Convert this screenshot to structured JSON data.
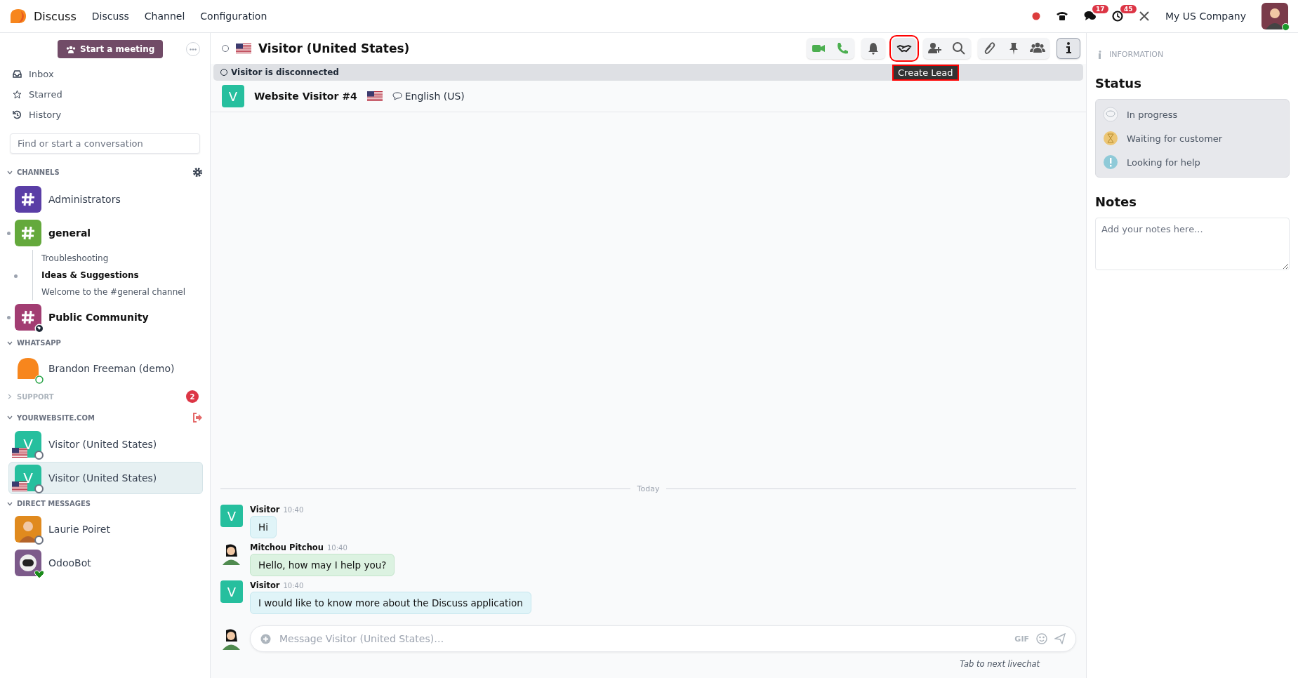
{
  "app_name": "Discuss",
  "menu": [
    "Discuss",
    "Channel",
    "Configuration"
  ],
  "systray": {
    "chat_count": "17",
    "activity_count": "45",
    "company": "My US Company"
  },
  "sidebar": {
    "meeting_button": "Start a meeting",
    "nav": [
      {
        "label": "Inbox",
        "kind": "inbox"
      },
      {
        "label": "Starred",
        "kind": "star"
      },
      {
        "label": "History",
        "kind": "history"
      }
    ],
    "search_placeholder": "Find or start a conversation",
    "sections": [
      {
        "title": "CHANNELS",
        "expanded": true,
        "kind": "settings",
        "items": [
          {
            "name": "Administrators",
            "kind": "channel",
            "color": "#5a3ea6",
            "unread": false,
            "selected": false
          },
          {
            "name": "general",
            "kind": "channel",
            "color": "#64a93c",
            "unread": true,
            "selected": false,
            "children": [
              {
                "name": "Troubleshooting",
                "unread": false,
                "selected": false
              },
              {
                "name": "Ideas & Suggestions",
                "unread": true,
                "selected": false
              },
              {
                "name": "Welcome to the #general channel",
                "unread": false,
                "selected": false
              }
            ]
          },
          {
            "name": "Public Community",
            "kind": "channel",
            "color": "#a23d72",
            "unread": true,
            "public": true,
            "selected": false
          }
        ]
      },
      {
        "title": "WHATSAPP",
        "expanded": true,
        "items": [
          {
            "name": "Brandon Freeman (demo)",
            "kind": "whatsapp",
            "unread": false,
            "selected": false
          }
        ]
      },
      {
        "title": "SUPPORT",
        "expanded": false,
        "badge": "2"
      },
      {
        "title": "YOURWEBSITE.COM",
        "expanded": true,
        "kind": "leave",
        "items": [
          {
            "name": "Visitor (United States)",
            "kind": "visitor",
            "initial": "V",
            "online": false,
            "unread": false,
            "selected": false
          },
          {
            "name": "Visitor (United States)",
            "kind": "visitor",
            "initial": "V",
            "online": false,
            "unread": false,
            "selected": true
          }
        ]
      },
      {
        "title": "DIRECT MESSAGES",
        "expanded": true,
        "items": [
          {
            "name": "Laurie Poiret",
            "kind": "user",
            "online": false,
            "unread": false,
            "selected": false
          },
          {
            "name": "OdooBot",
            "kind": "bot",
            "online": true,
            "unread": false,
            "selected": false
          }
        ]
      }
    ]
  },
  "thread": {
    "online": false,
    "title": "Visitor (United States)",
    "toolbar": [
      {
        "buttons": [
          {
            "kind": "video",
            "active": false,
            "highlighted": false
          },
          {
            "kind": "phone",
            "active": false,
            "highlighted": false
          }
        ]
      },
      {
        "buttons": [
          {
            "kind": "bell",
            "active": false,
            "highlighted": false
          }
        ]
      },
      {
        "buttons": [
          {
            "kind": "handshake",
            "active": false,
            "highlighted": true
          }
        ]
      },
      {
        "buttons": [
          {
            "kind": "add-user",
            "active": false,
            "highlighted": false
          },
          {
            "kind": "search",
            "active": false,
            "highlighted": false
          }
        ]
      },
      {
        "buttons": [
          {
            "kind": "paperclip",
            "active": false,
            "highlighted": false
          },
          {
            "kind": "pin",
            "active": false,
            "highlighted": false
          },
          {
            "kind": "members",
            "active": false,
            "highlighted": false
          }
        ]
      },
      {
        "buttons": [
          {
            "kind": "info",
            "active": true,
            "highlighted": false
          }
        ]
      }
    ],
    "tooltip": {
      "text": "Create Lead",
      "highlighted": true
    },
    "banner": "Visitor is disconnected",
    "visitor": {
      "initial": "V",
      "name": "Website Visitor #4",
      "language": "English (US)"
    },
    "separator": "Today",
    "messages": [
      {
        "kind": "visitor",
        "initial": "V",
        "author": "Visitor",
        "time": "10:40",
        "text": "Hi"
      },
      {
        "kind": "agent",
        "author": "Mitchou Pitchou",
        "time": "10:40",
        "text": "Hello, how may I help you?"
      },
      {
        "kind": "visitor",
        "initial": "V",
        "author": "Visitor",
        "time": "10:40",
        "text": "I would like to know more about the Discuss application"
      }
    ],
    "composer": {
      "placeholder": "Message Visitor (United States)…",
      "gif": "GIF"
    },
    "hint": "Tab to next livechat"
  },
  "panel": {
    "header": "INFORMATION",
    "status_title": "Status",
    "statuses": [
      {
        "label": "In progress",
        "kind": "progress"
      },
      {
        "label": "Waiting for customer",
        "kind": "waiting"
      },
      {
        "label": "Looking for help",
        "kind": "help"
      }
    ],
    "notes_title": "Notes",
    "notes_placeholder": "Add your notes here..."
  }
}
